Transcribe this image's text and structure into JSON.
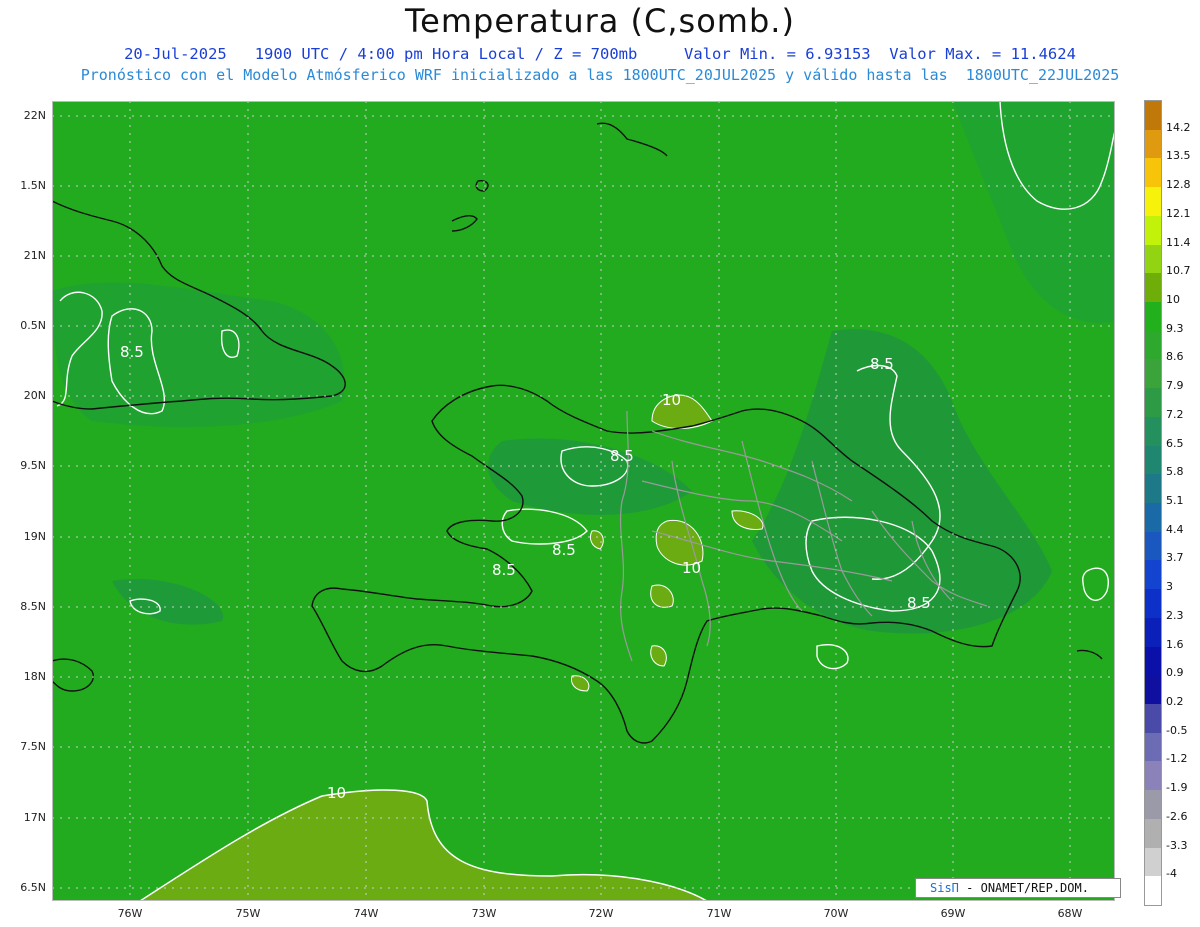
{
  "title": "Temperatura (C,somb.)",
  "subtitle_line1": "20-Jul-2025   1900 UTC / 4:00 pm Hora Local / Z = 700mb     Valor Min. = 6.93153  Valor Max. = 11.4624",
  "subtitle_line2": "Pronóstico con el Modelo Atmósferico WRF inicializado a las 1800UTC_20JUL2025 y válido hasta las  1800UTC_22JUL2025",
  "lat_labels": [
    "22N",
    "1.5N",
    "21N",
    "0.5N",
    "20N",
    "9.5N",
    "19N",
    "8.5N",
    "18N",
    "7.5N",
    "17N",
    "6.5N"
  ],
  "lon_labels": [
    "76W",
    "75W",
    "74W",
    "73W",
    "72W",
    "71W",
    "70W",
    "69W",
    "68W"
  ],
  "contour_labels": [
    "8.5",
    "8.5",
    "8.5",
    "8.5",
    "8.5",
    "10",
    "10",
    "10",
    "8.5"
  ],
  "colorbar": {
    "labels": [
      "14.2",
      "13.5",
      "12.8",
      "12.1",
      "11.4",
      "10.7",
      "10",
      "9.3",
      "8.6",
      "7.9",
      "7.2",
      "6.5",
      "5.8",
      "5.1",
      "4.4",
      "3.7",
      "3",
      "2.3",
      "1.6",
      "0.9",
      "0.2",
      "-0.5",
      "-1.2",
      "-1.9",
      "-2.6",
      "-3.3",
      "-4"
    ],
    "colors": [
      "#c07808",
      "#e09a10",
      "#f7c40a",
      "#f6f20c",
      "#c2f20a",
      "#92d411",
      "#6fae09",
      "#22b01c",
      "#2ea92d",
      "#3aa43a",
      "#2d9a46",
      "#24905e",
      "#1f8670",
      "#1d7888",
      "#1a6aa8",
      "#1a58c0",
      "#1244d0",
      "#0c30c8",
      "#0a20b8",
      "#0a10a8",
      "#1010a0",
      "#4a4aa8",
      "#6c6cb4",
      "#8a82b8",
      "#9a9aa8",
      "#b0b0b0",
      "#d0d0d0",
      "#ffffff"
    ]
  },
  "credit": {
    "brand": "SisΠ",
    "text": "- ONAMET/REP.DOM."
  },
  "colors": {
    "field_green": "#22ab1f",
    "field_dark": "#1f9a38",
    "field_warm": "#6aac12",
    "contour": "#ffffff",
    "coast": "#111111",
    "province": "#9a9a9a"
  }
}
